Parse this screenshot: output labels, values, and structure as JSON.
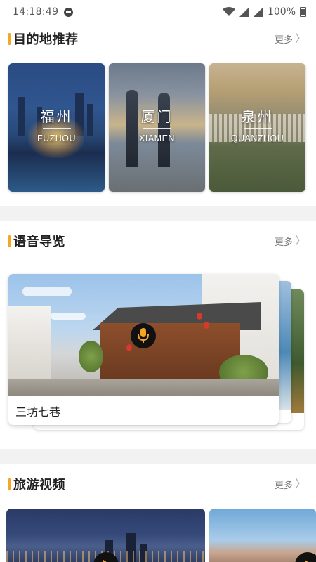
{
  "status_bar": {
    "time": "14:18:49",
    "battery": "100%"
  },
  "destinations": {
    "title": "目的地推荐",
    "more_label": "更多",
    "cards": [
      {
        "city": "福州",
        "en": "FUZHOU"
      },
      {
        "city": "厦门",
        "en": "XIAMEN"
      },
      {
        "city": "泉州",
        "en": "QUANZHOU"
      }
    ]
  },
  "voice_guide": {
    "title": "语音导览",
    "more_label": "更多",
    "items": [
      {
        "label": "三坊七巷"
      }
    ]
  },
  "travel_videos": {
    "title": "旅游视频",
    "more_label": "更多"
  },
  "colors": {
    "accent": "#f5a623",
    "text": "#222222",
    "muted": "#777777"
  }
}
